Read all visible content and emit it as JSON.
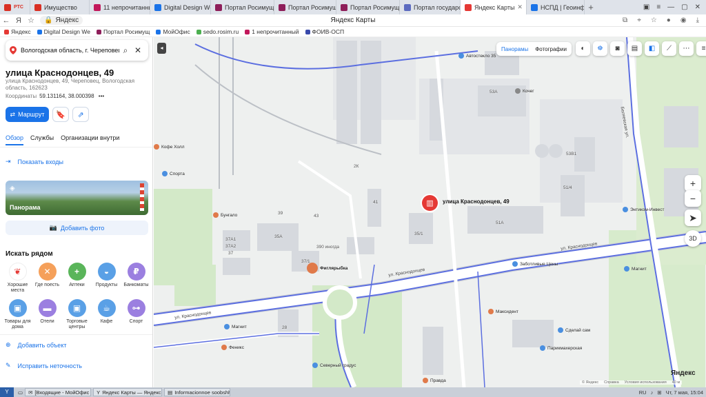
{
  "browser": {
    "tabs": [
      {
        "label": "Имущество",
        "color": "#d93025"
      },
      {
        "label": "11 непрочитанных",
        "color": "#c2185b"
      },
      {
        "label": "Digital Design Web",
        "color": "#1a73e8"
      },
      {
        "label": "Портал Росимущ...",
        "color": "#8e1e5a"
      },
      {
        "label": "Портал Росимущ...",
        "color": "#8e1e5a"
      },
      {
        "label": "Портал Росимущ...",
        "color": "#8e1e5a"
      },
      {
        "label": "Портал государство",
        "color": "#5c6bc0"
      },
      {
        "label": "Яндекс Карты",
        "color": "#e53935"
      },
      {
        "label": "НСПД | Геоинформ...",
        "color": "#1a73e8"
      }
    ],
    "new_tab": "+",
    "tab_brand": "РТС",
    "address": "Яндекс",
    "page_title": "Яндекс Карты",
    "bookmarks": [
      {
        "label": "Яндекс",
        "color": "#e53935"
      },
      {
        "label": "Digital Design We",
        "color": "#1a73e8"
      },
      {
        "label": "Портал Росимущ",
        "color": "#8e1e5a"
      },
      {
        "label": "МойОфис",
        "color": "#1a73e8"
      },
      {
        "label": "sedo.rosim.ru",
        "color": "#4caf50"
      },
      {
        "label": "1 непрочитанный",
        "color": "#c2185b"
      },
      {
        "label": "ФОИВ-ОСП",
        "color": "#3949ab"
      }
    ]
  },
  "sidebar": {
    "search_query": "Вологодская область, г. Череповец,",
    "place_title": "улица Краснодонцев, 49",
    "place_address": "улица Краснодонцев, 49, Череповец, Вологодская область, 162623",
    "coords_label": "Координаты",
    "coords_value": "59.131164, 38.000398",
    "route_label": "Маршрут",
    "tabs": [
      "Обзор",
      "Службы",
      "Организации внутри"
    ],
    "show_entrances": "Показать входы",
    "panorama_label": "Панорама",
    "add_photo": "Добавить фото",
    "nearby_title": "Искать рядом",
    "categories": [
      {
        "label": "Хорошие места",
        "color": "#ffffff",
        "icon": "pin-icon"
      },
      {
        "label": "Где поесть",
        "color": "#f5a05a",
        "icon": "fork-icon"
      },
      {
        "label": "Аптеки",
        "color": "#5ab55a",
        "icon": "cross-icon"
      },
      {
        "label": "Продукты",
        "color": "#5aa0e6",
        "icon": "basket-icon"
      },
      {
        "label": "Банкоматы",
        "color": "#9b7fe0",
        "icon": "ruble-icon"
      },
      {
        "label": "Товары для дома",
        "color": "#5aa0e6",
        "icon": "bag-icon"
      },
      {
        "label": "Отели",
        "color": "#9b7fe0",
        "icon": "bed-icon"
      },
      {
        "label": "Торговые центры",
        "color": "#5aa0e6",
        "icon": "bag-icon"
      },
      {
        "label": "Кафе",
        "color": "#5aa0e6",
        "icon": "cup-icon"
      },
      {
        "label": "Спорт",
        "color": "#9b7fe0",
        "icon": "dumbbell-icon"
      }
    ],
    "add_object": "Добавить объект",
    "fix_error": "Исправить неточность"
  },
  "map": {
    "layers": [
      "Панорамы",
      "Фотографии"
    ],
    "marker_label": "улица Краснодонцев, 49",
    "zoom_in": "+",
    "zoom_out": "−",
    "mode_3d": "3D",
    "logo": "Яндекс",
    "footer": [
      "© Яндекс",
      "Справка",
      "Условия использования",
      "40 м"
    ],
    "streets": [
      "ул. Краснодонцев",
      "ул. Краснодонцев",
      "ул. Краснодонцев",
      "Беляевская ул."
    ],
    "pois": [
      {
        "label": "Автостекло 35",
        "color": "#4a8fe0"
      },
      {
        "label": "Кочег",
        "color": "#888888"
      },
      {
        "label": "Спорта",
        "color": "#4a8fe0"
      },
      {
        "label": "Бунгало",
        "color": "#e07a4a"
      },
      {
        "label": "Энтиком-Инвест",
        "color": "#4a8fe0"
      },
      {
        "label": "Заботливые Цены",
        "color": "#4a8fe0"
      },
      {
        "label": "Магнит",
        "color": "#4a8fe0"
      },
      {
        "label": "Фиглярыбка",
        "color": "#e07a4a"
      },
      {
        "label": "Максидент",
        "color": "#e07a4a"
      },
      {
        "label": "Магнит",
        "color": "#4a8fe0"
      },
      {
        "label": "Сделай сам",
        "color": "#4a8fe0"
      },
      {
        "label": "Феникс",
        "color": "#e07a4a"
      },
      {
        "label": "Парикмахерская",
        "color": "#4a8fe0"
      },
      {
        "label": "Северный градус",
        "color": "#4a8fe0"
      },
      {
        "label": "Правда",
        "color": "#e07a4a"
      },
      {
        "label": "Кофе Холл",
        "color": "#e07a4a"
      }
    ],
    "buildings": [
      "53А",
      "51/4",
      "51А",
      "2К",
      "41",
      "43",
      "39",
      "35А",
      "37",
      "37А1",
      "37А2",
      "37/1",
      "390 иногда",
      "35/1",
      "28",
      "53В1"
    ],
    "colors": {
      "accent": "#1a73e8",
      "marker": "#e53935",
      "green": "#cfe8c4",
      "road": "#ffffff",
      "route": "#5b6ee0"
    }
  },
  "taskbar": {
    "start": "Y",
    "items": [
      "[Входящие - МойОфис П...",
      "Яндекс Карты — Яндекс...",
      "Informacionnoe soobshhe..."
    ],
    "lang": "RU",
    "clock": "Чт, 7 мая, 15:04"
  }
}
